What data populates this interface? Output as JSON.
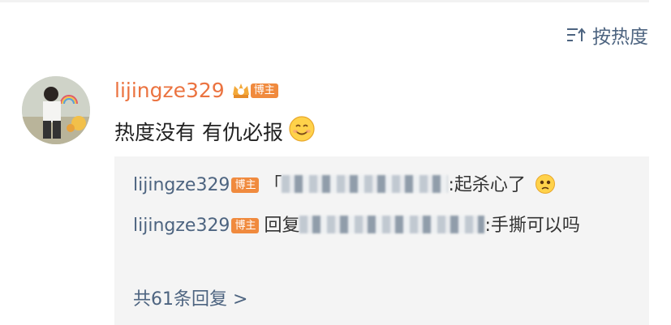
{
  "sort": {
    "label": "按热度",
    "icon": "sort-lines-icon"
  },
  "comment": {
    "username": "lijingze329",
    "badge": "博主",
    "text": "热度没有 有仇必报",
    "emoji": "smile-emoji"
  },
  "replies": [
    {
      "username": "lijingze329",
      "badge": "博主",
      "prefix": "「",
      "text": ":起杀心了",
      "emoji": "sad-emoji"
    },
    {
      "username": "lijingze329",
      "badge": "博主",
      "prefix": "回复",
      "text": ":手撕可以吗"
    }
  ],
  "more_replies": "共61条回复 >",
  "colors": {
    "username_orange": "#eb7340",
    "link_blue": "#4d6480",
    "badge_orange": "#f08a3e"
  }
}
